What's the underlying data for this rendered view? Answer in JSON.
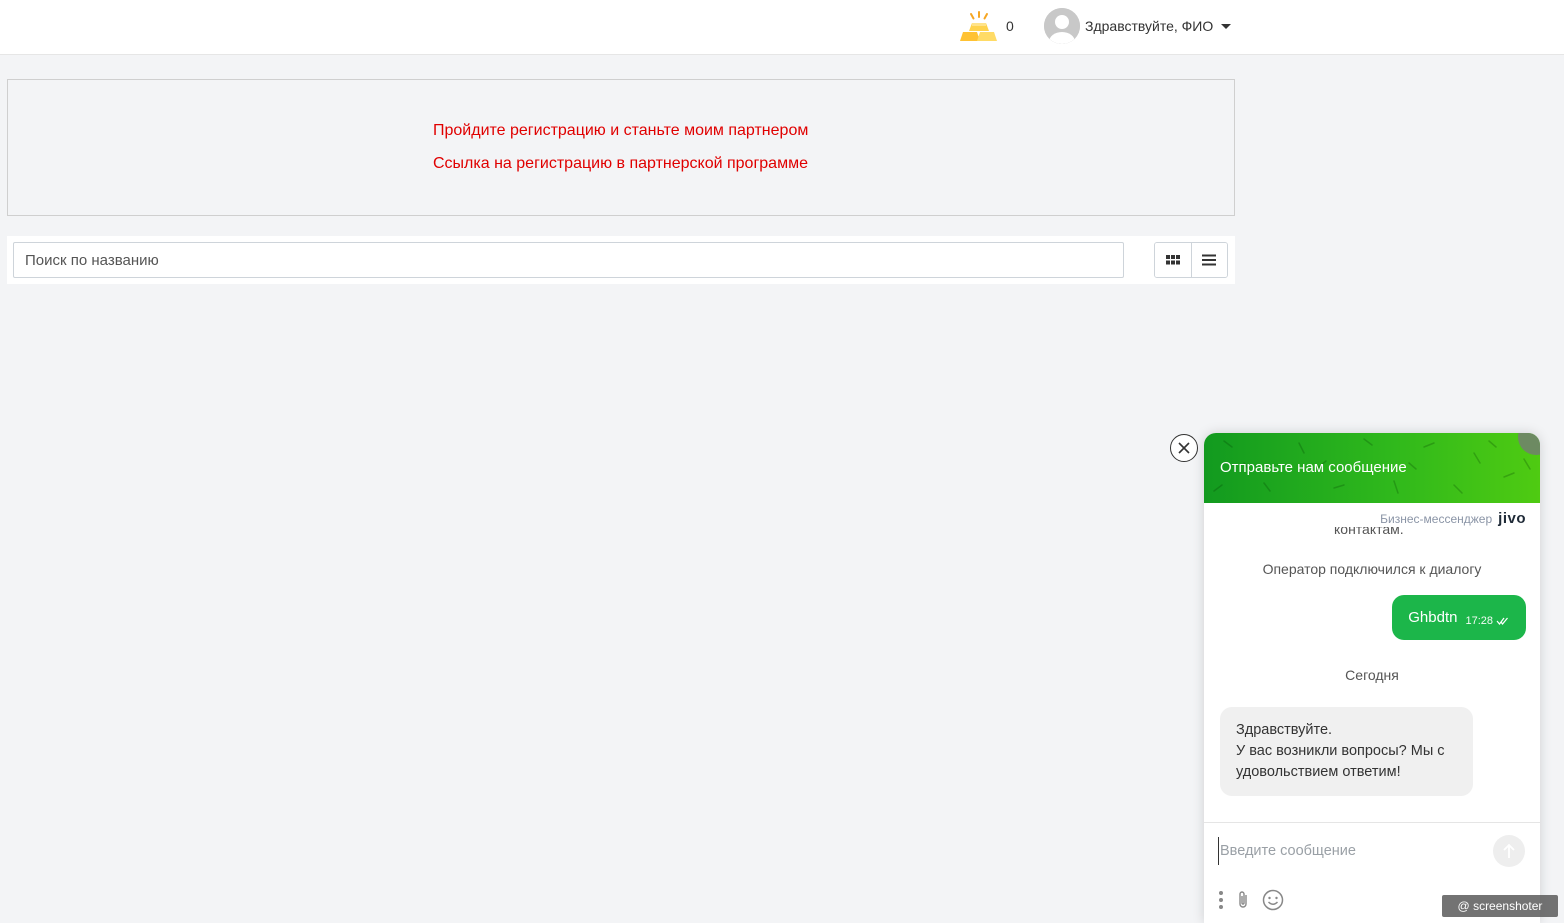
{
  "header": {
    "gold_count": "0",
    "greeting": "Здравствуйте, ФИО",
    "icons": {
      "gold": "gold-bars-icon",
      "avatar": "user-avatar-icon",
      "caret": "chevron-down-icon"
    }
  },
  "partner": {
    "register_link": "Пройдите регистрацию и станьте моим партнером",
    "program_link": "Ссылка на регистрацию в партнерской программе",
    "link_color": "#e00000"
  },
  "search": {
    "placeholder": "Поиск по названию",
    "value": "",
    "views": [
      "grid-view-icon",
      "list-view-icon"
    ]
  },
  "chat": {
    "title": "Отправьте нам сообщение",
    "brand_text": "Бизнес-мессенджер",
    "brand_logo": "jivo",
    "clipped_text": "контактам.",
    "operator_joined": "Оператор подключился к диалогу",
    "outgoing": {
      "text": "Ghbdtn",
      "time": "17:28"
    },
    "date_separator": "Сегодня",
    "incoming": {
      "line1": "Здравствуйте.",
      "line2": "У вас возникли вопросы? Мы с удовольствием ответим!"
    },
    "input_placeholder": "Введите сообщение",
    "accent_color": "#1cb64a"
  },
  "watermark": "@ screenshoter"
}
